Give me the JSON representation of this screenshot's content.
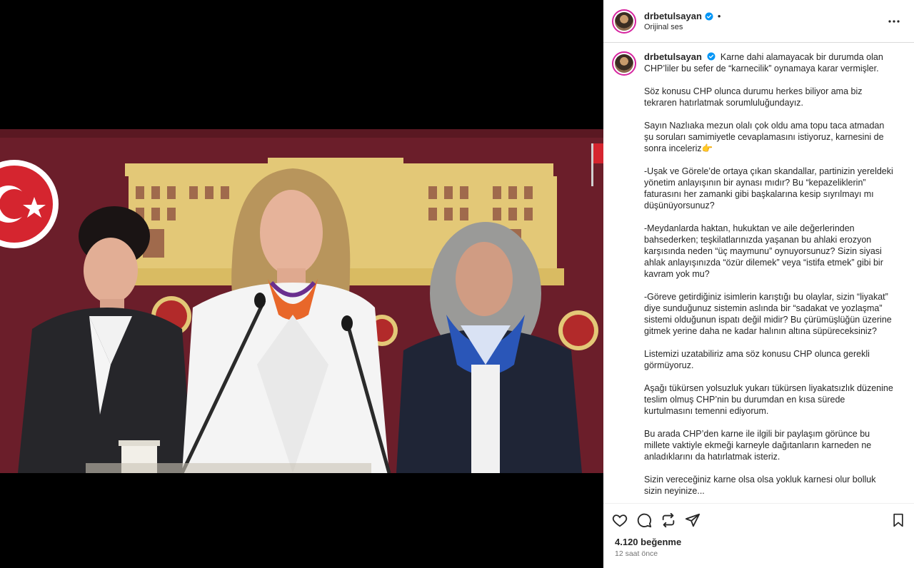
{
  "post": {
    "username": "drbetulsayan",
    "separator": "•",
    "audio": "Orijinal ses",
    "caption_first": "Karne dahi alamayacak bir durumda olan CHP’liler bu sefer de “karnecilik” oynamaya karar vermişler.",
    "caption_paragraphs": [
      "Söz konusu CHP olunca durumu herkes biliyor ama biz tekraren hatırlatmak sorumluluğundayız.",
      "Sayın Nazlıaka mezun olalı çok oldu ama topu taca atmadan şu soruları samimiyetle cevaplamasını istiyoruz, karnesini de sonra inceleriz👉",
      "-Uşak ve Görele’de ortaya çıkan skandallar, partinizin yereldeki yönetim anlayışının bir aynası mıdır? Bu “kepazeliklerin” faturasını her zamanki gibi başkalarına kesip sıyrılmayı mı düşünüyorsunuz?",
      "-Meydanlarda haktan, hukuktan ve aile değerlerinden bahsederken; teşkilatlarınızda yaşanan bu ahlaki erozyon karşısında neden “üç maymunu” oynuyorsunuz? Sizin siyasi ahlak anlayışınızda “özür dilemek” veya “istifa etmek” gibi bir kavram yok mu?",
      "-Göreve getirdiğiniz isimlerin karıştığı bu olaylar, sizin “liyakat” diye sunduğunuz sistemin aslında bir “sadakat ve yozlaşma” sistemi olduğunun ispatı değil midir? Bu çürümüşlüğün üzerine gitmek yerine daha ne kadar halının altına süpüreceksiniz?",
      "Listemizi uzatabiliriz ama söz konusu CHP olunca gerekli görmüyoruz.",
      "Aşağı tükürsen yolsuzluk yukarı tükürsen liyakatsızlık düzenine teslim olmuş CHP’nin bu durumdan en kısa sürede kurtulmasını temenni ediyorum.",
      "Bu arada CHP’den karne ile ilgili bir paylaşım görünce bu millete vaktiyle ekmeği karneyle dağıtanların karneden ne anladıklarını da hatırlatmak isteriz.",
      "Sizin vereceğiniz karne olsa olsa yokluk karnesi olur bolluk sizin neyinize..."
    ],
    "caption_time": "12s",
    "likes": "4.120 beğenme",
    "posted_ago": "12 saat önce"
  },
  "icons": {
    "verified": "verified-badge-icon",
    "more": "more-options-icon",
    "like": "heart-icon",
    "comment": "comment-icon",
    "repost": "repost-icon",
    "share": "share-icon",
    "save": "bookmark-icon",
    "mute": "muted-speaker-icon"
  },
  "colors": {
    "verified": "#0095f6",
    "avatar_ring": "#d6249f",
    "secondary_text": "#737373",
    "backdrop": "#6b1e2a",
    "building": "#e3c877"
  }
}
